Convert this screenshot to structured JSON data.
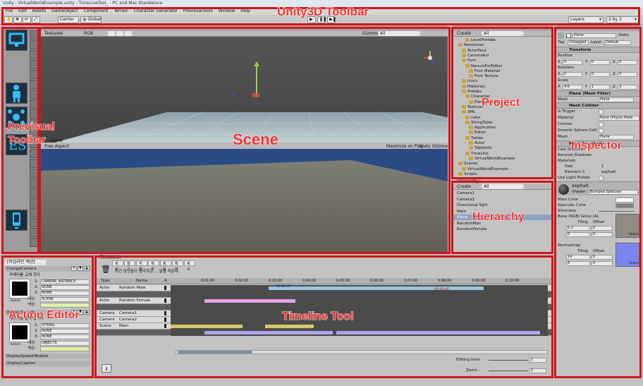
{
  "window": {
    "title": "Unity - VirtualWorldExample.unity - TimeLineTool_ - PC and Mac Standalone"
  },
  "menu": [
    "File",
    "Edit",
    "Assets",
    "GameObject",
    "Component",
    "Terrain",
    "Character Generator",
    "PrevisualTools",
    "Window",
    "Help"
  ],
  "toolbar": {
    "center_label": "Center",
    "global_label": "Global",
    "layers_label": "Layers",
    "layout_label": "2 by 3"
  },
  "annotations": {
    "toolbar": "Unity3D Toolbar",
    "previsual": "Previsual\nToolbar",
    "scene": "Scene",
    "project": "Project",
    "inspector": "Inspector",
    "hierarchy": "Hierarchy",
    "action_editor": "Action Editor",
    "timeline": "Timeline Tool"
  },
  "scene": {
    "mode": "Textured",
    "render": "RGB",
    "gizmos": "Gizmos",
    "search": "All",
    "game_tab": "Game",
    "aspect": "Free Aspect",
    "maximize": "Maximize on Play",
    "stats": "Stats",
    "gizmos2": "Gizmos"
  },
  "project": {
    "create": "Create",
    "search": "All",
    "rows": [
      {
        "text": "LevelPrefabs",
        "indent": 3
      },
      {
        "text": "Resources",
        "indent": 1
      },
      {
        "text": "ActorFace",
        "indent": 2
      },
      {
        "text": "CameraAni",
        "indent": 2
      },
      {
        "text": "Font",
        "indent": 2
      },
      {
        "text": "NanumForEditor",
        "indent": 3
      },
      {
        "text": "Font Material",
        "indent": 4
      },
      {
        "text": "Font Texture",
        "indent": 4
      },
      {
        "text": "Icons",
        "indent": 2
      },
      {
        "text": "Materials",
        "indent": 2
      },
      {
        "text": "Prefabs",
        "indent": 2
      },
      {
        "text": "Character",
        "indent": 3
      },
      {
        "text": "Plane_Buildi",
        "indent": 4
      },
      {
        "text": "Textures",
        "indent": 2
      },
      {
        "text": "XML",
        "indent": 2
      },
      {
        "text": "rules",
        "indent": 3
      },
      {
        "text": "StringTable",
        "indent": 3
      },
      {
        "text": "Application",
        "indent": 4
      },
      {
        "text": "Editor",
        "indent": 4
      },
      {
        "text": "Tables",
        "indent": 3
      },
      {
        "text": "Actor",
        "indent": 4
      },
      {
        "text": "TableInfo",
        "indent": 4
      },
      {
        "text": "TimeLine",
        "indent": 3
      },
      {
        "text": "VirtualWorldExample",
        "indent": 4
      },
      {
        "text": "Scenes",
        "indent": 1
      },
      {
        "text": "VirtualWorldExample",
        "indent": 2
      },
      {
        "text": "Scripts",
        "indent": 1
      }
    ]
  },
  "hierarchy": {
    "title": "Hierarchy",
    "create": "Create",
    "search": "All",
    "items": [
      "Camera1",
      "Camera2",
      "Directional light",
      "Main",
      "Plane",
      "RandomMan",
      "RandomFemale"
    ],
    "selected": "Plane"
  },
  "inspector": {
    "name": "Plane",
    "static": "Static",
    "tag_label": "Tag",
    "tag": "Untagged",
    "layer_label": "Layer",
    "layer": "Default",
    "transform": "Transform",
    "position": "Position",
    "pos": [
      "5",
      "0",
      "5"
    ],
    "rotation": "Rotation",
    "rot": [
      "0",
      "0",
      "0"
    ],
    "scale": "Scale",
    "scl": [
      "4.6",
      "1",
      "3"
    ],
    "axes": [
      "X",
      "Y",
      "Z"
    ],
    "mesh_filter": "Plane (Mesh Filter)",
    "mesh_label": "Mesh",
    "mesh_value": "Plane",
    "mesh_collider": "Mesh Collider",
    "is_trigger": "Is Trigger",
    "material_label": "Material",
    "material_value": "None (Physic Mate",
    "convex": "Convex",
    "smooth": "Smooth Sphere Colli",
    "mesh2_label": "Mesh",
    "mesh2_value": "Plane",
    "mesh_renderer": "Mesh Renderer",
    "cast_shadows": "Cast Shadows",
    "receive_shadows": "Receive Shadows",
    "materials": "Materials",
    "size_label": "Size",
    "size_value": "1",
    "element_label": "Element 0",
    "element_value": "asphalt",
    "light_probes": "Use Light Probes",
    "mat_name": "asphalt",
    "shader_label": "Shader",
    "shader": "Bumped Specular",
    "main_color": "Main Color",
    "specular_color": "Specular Color",
    "shininess": "Shininess",
    "base_label": "Base (RGB) Gloss (A)",
    "tiling": "Tiling",
    "offset": "Offset",
    "base_x": "6.2",
    "base_x_off": "0",
    "base_y": "6",
    "base_y_off": "0",
    "select": "Select",
    "normalmap": "Normalmap",
    "norm_x": "14",
    "norm_x_off": "0",
    "norm_y": "6",
    "norm_y_off": "0",
    "select2": "Select"
  },
  "action_editor": {
    "title": "[타임라인 액션]",
    "groups": [
      {
        "name": "ChangeCamera",
        "subtitle": "카메라를 교체 한다",
        "params": [
          "CAMERA_INSTANCE",
          "NONE",
          "NONE"
        ],
        "target_label": "대상:",
        "target": "SCENE",
        "color_label": "색상:"
      },
      {
        "name": "DisplaySpeech",
        "subtitle": "메시지를 출력 합니다",
        "params": [
          "STRING",
          "NONE",
          "NONE"
        ],
        "target_label": "대상:",
        "target": "OBJECTS",
        "color_label": "색상:"
      }
    ],
    "footer_items": [
      "DisplaySpeechBubble",
      "DisplayCaption"
    ],
    "select": "Select"
  },
  "timeline": {
    "tab": "TimeLine",
    "buttons": [
      "새로",
      "열기",
      "저장",
      "재생",
      "정지",
      "확대",
      "축소"
    ],
    "message": "이건 당신들이 생각하는 ... 말을 띄운다.",
    "col_type": "Type",
    "col_name": "Name",
    "col_a": "A",
    "ticks": [
      "0:01:00",
      "0:02:00",
      "0:03:00",
      "0:04:00",
      "0:05:00",
      "0:06:00",
      "0:07:00",
      "0:08:00",
      "0:09:00",
      "0:10:00"
    ],
    "tracks": [
      {
        "type": "Actor",
        "name": "Random Male",
        "clips": [
          {
            "s": 0.26,
            "e": 0.83,
            "c": "#99c4df"
          }
        ]
      },
      {
        "type": "",
        "name": "",
        "clips": []
      },
      {
        "type": "Actor",
        "name": "Random Female",
        "clips": [
          {
            "s": 0.09,
            "e": 0.33,
            "c": "#eaa1e4"
          }
        ]
      },
      {
        "type": "",
        "name": "",
        "clips": []
      },
      {
        "type": "Camera",
        "name": "Camera1",
        "clips": []
      },
      {
        "type": "Camera",
        "name": "Camera2",
        "clips": []
      },
      {
        "type": "Scene",
        "name": "Main",
        "clips": [
          {
            "s": 0.0,
            "e": 0.19,
            "c": "#d6c96a"
          },
          {
            "s": 0.25,
            "e": 0.38,
            "c": "#d6c96a"
          }
        ]
      },
      {
        "type": "",
        "name": "",
        "clips": [
          {
            "s": 0.09,
            "e": 0.43,
            "c": "#b2a4ec"
          },
          {
            "s": 0.44,
            "e": 0.98,
            "c": "#b2a4ec"
          }
        ]
      }
    ],
    "marker1": "00:03:37",
    "marker2": "00:06:46",
    "editing_time": "Editing time :",
    "editing_value": "1",
    "zoom": "Zoom :",
    "zoom_value": "1"
  }
}
